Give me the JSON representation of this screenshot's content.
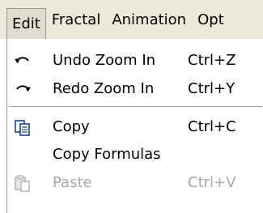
{
  "menubar": {
    "items": [
      "Edit",
      "Fractal",
      "Animation",
      "Opt"
    ]
  },
  "menu": {
    "undo": {
      "label": "Undo Zoom In",
      "shortcut": "Ctrl+Z",
      "icon": "undo-icon"
    },
    "redo": {
      "label": "Redo Zoom In",
      "shortcut": "Ctrl+Y",
      "icon": "redo-icon"
    },
    "copy": {
      "label": "Copy",
      "shortcut": "Ctrl+C",
      "icon": "copy-icon"
    },
    "copy_formulas": {
      "label": "Copy Formulas"
    },
    "paste": {
      "label": "Paste",
      "shortcut": "Ctrl+V",
      "icon": "paste-icon",
      "disabled": true
    }
  },
  "colors": {
    "menubar_bg": "#ece9d8",
    "disabled_text": "#a9a9a9"
  }
}
